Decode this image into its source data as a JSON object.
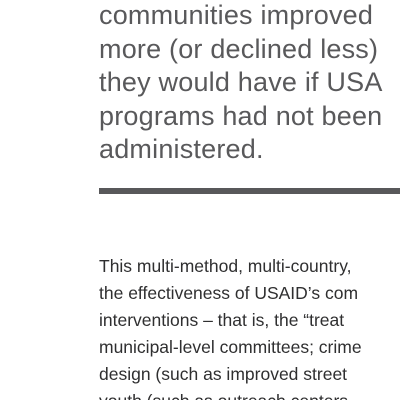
{
  "pull_quote": {
    "lines": [
      "communities improved",
      "more (or declined less)",
      "they would have if USA",
      "programs had not been",
      "administered."
    ]
  },
  "body": {
    "lines": [
      "This multi-method, multi-country,",
      "the effectiveness of USAID’s com",
      "interventions – that is, the “treat",
      "municipal-level committees; crime",
      "design (such as improved street",
      "youth (such as outreach centers"
    ]
  }
}
